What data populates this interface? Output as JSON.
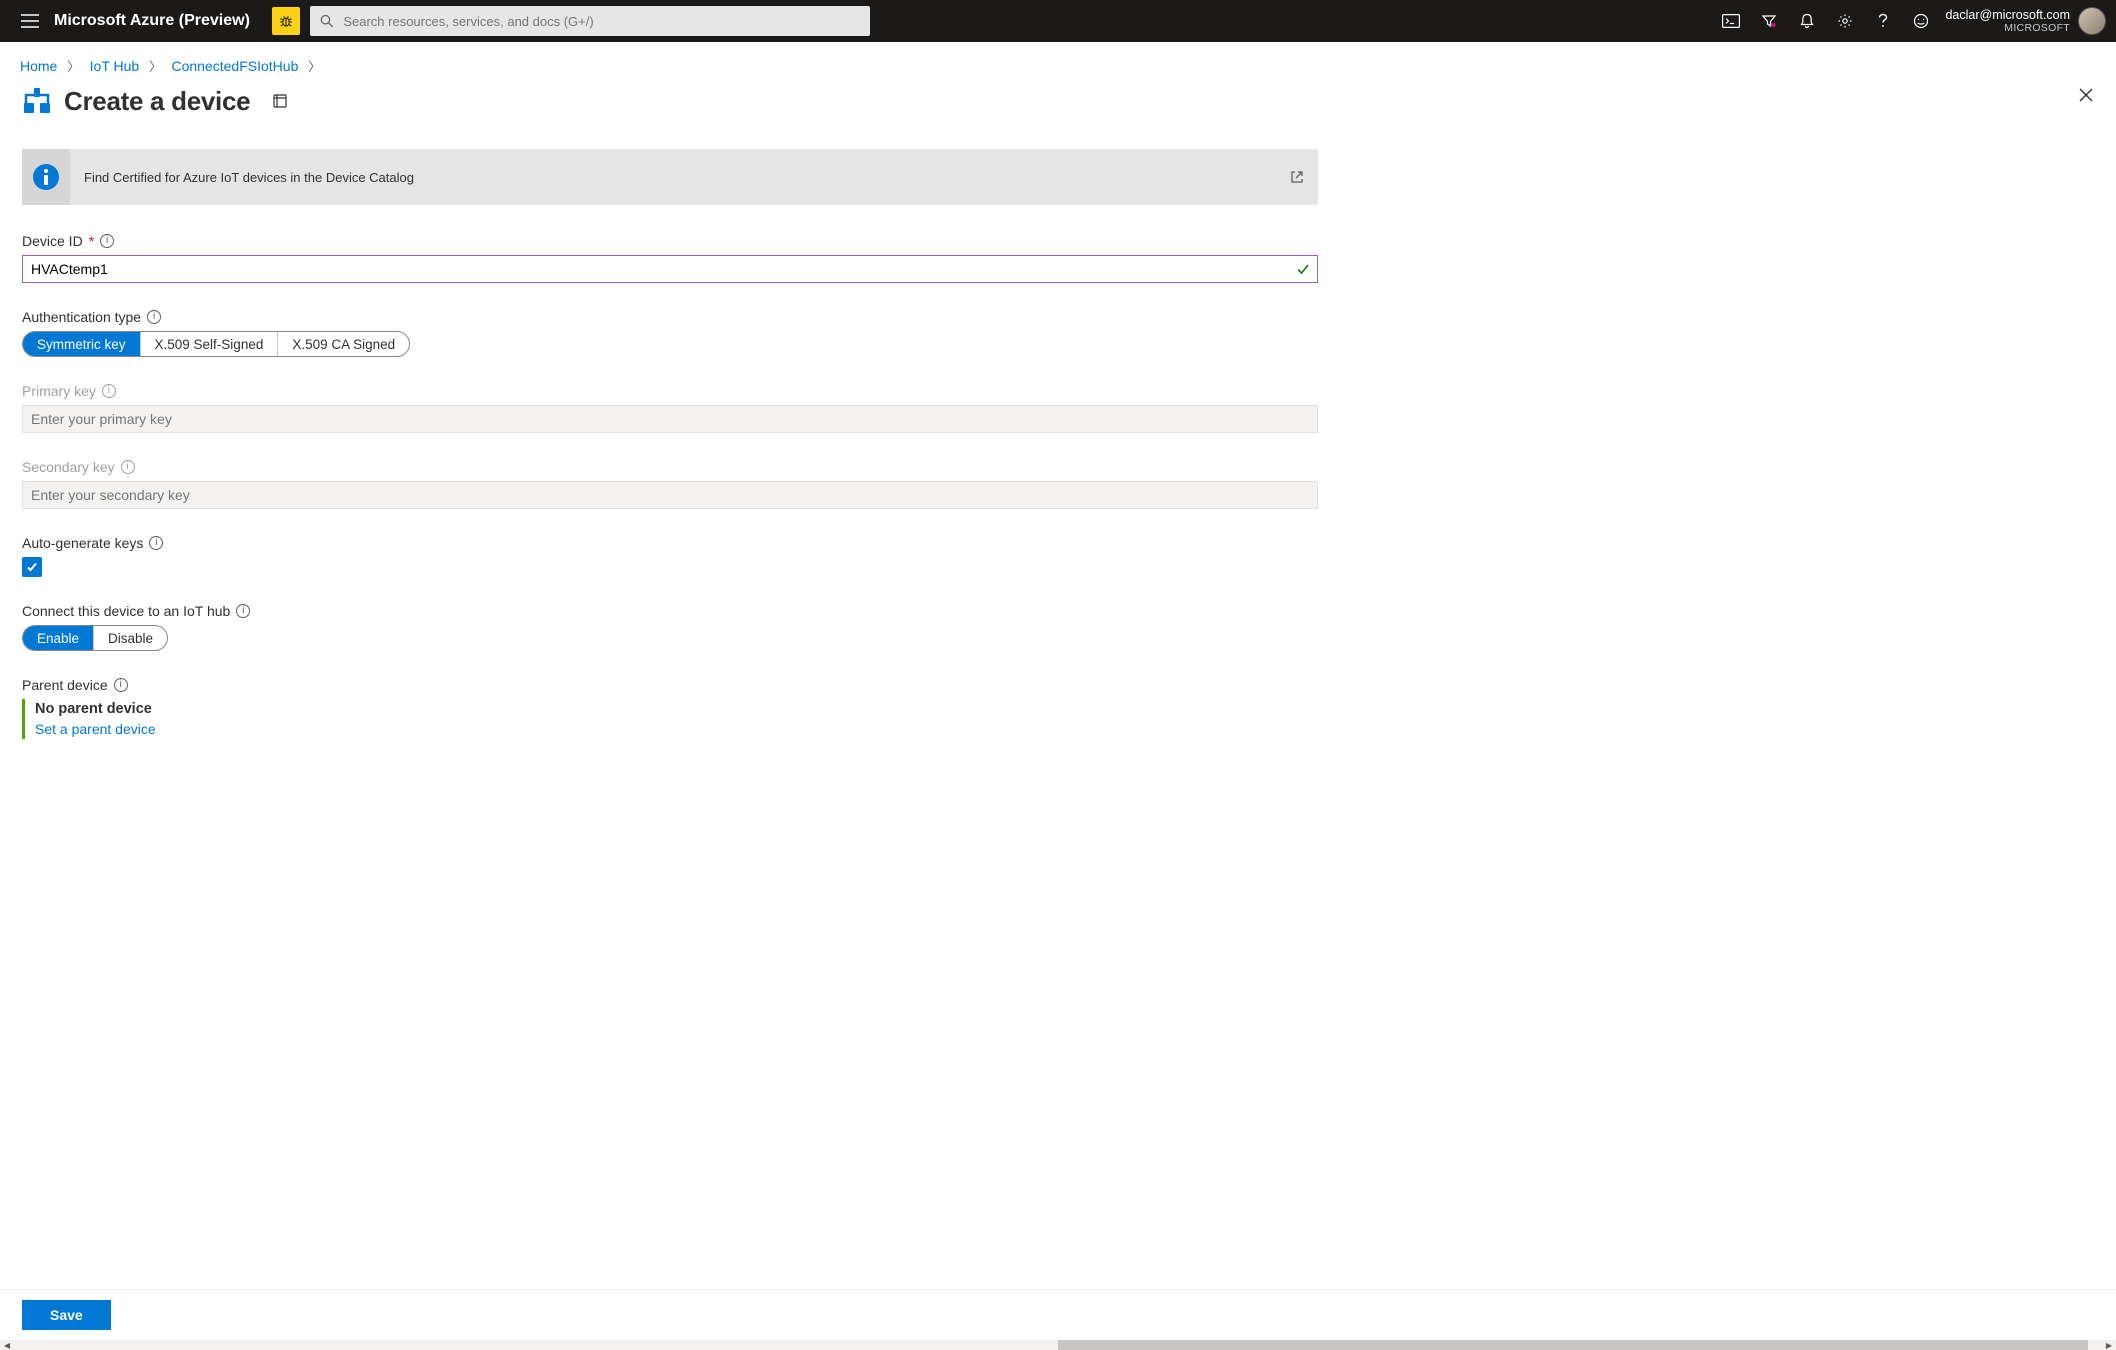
{
  "header": {
    "brand": "Microsoft Azure (Preview)",
    "search_placeholder": "Search resources, services, and docs (G+/)",
    "user_email": "daclar@microsoft.com",
    "user_org": "MICROSOFT"
  },
  "breadcrumbs": {
    "items": [
      "Home",
      "IoT Hub",
      "ConnectedFSIotHub"
    ]
  },
  "page": {
    "title": "Create a device"
  },
  "banner": {
    "text": "Find Certified for Azure IoT devices in the Device Catalog"
  },
  "form": {
    "device_id": {
      "label": "Device ID",
      "value": "HVACtemp1"
    },
    "auth_type": {
      "label": "Authentication type",
      "options": [
        "Symmetric key",
        "X.509 Self-Signed",
        "X.509 CA Signed"
      ],
      "selected_index": 0
    },
    "primary_key": {
      "label": "Primary key",
      "placeholder": "Enter your primary key"
    },
    "secondary_key": {
      "label": "Secondary key",
      "placeholder": "Enter your secondary key"
    },
    "auto_generate": {
      "label": "Auto-generate keys",
      "checked": true
    },
    "connect_hub": {
      "label": "Connect this device to an IoT hub",
      "options": [
        "Enable",
        "Disable"
      ],
      "selected_index": 0
    },
    "parent_device": {
      "label": "Parent device",
      "no_parent_text": "No parent device",
      "link_text": "Set a parent device"
    }
  },
  "footer": {
    "save_label": "Save"
  }
}
